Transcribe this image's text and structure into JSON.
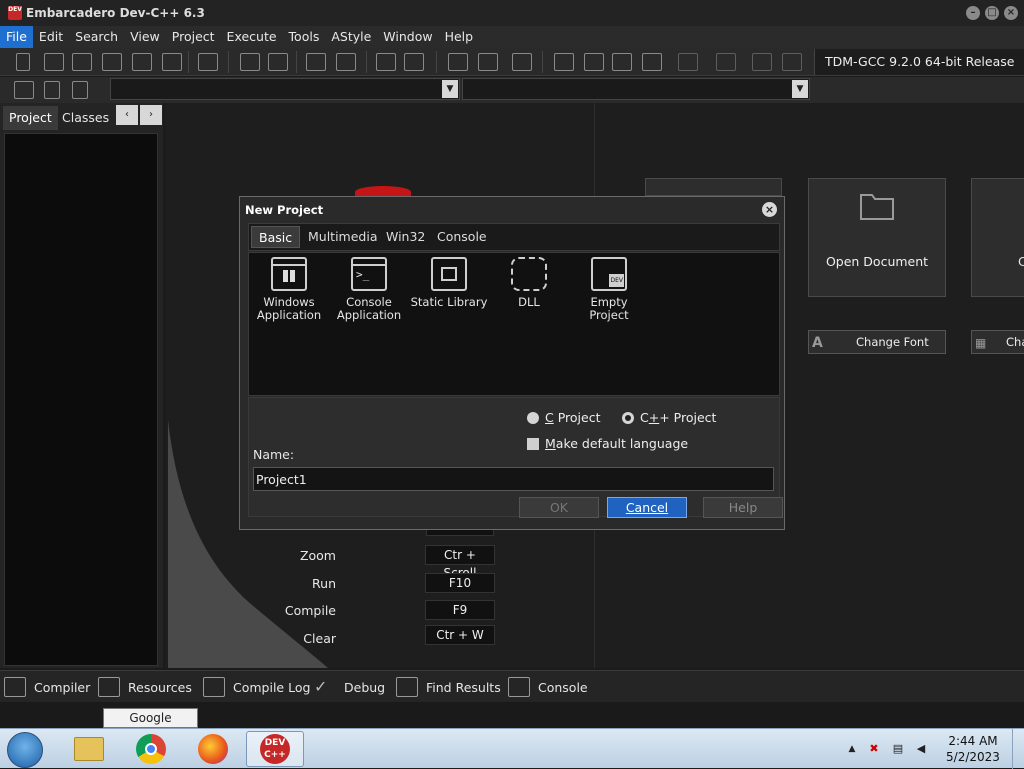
{
  "window": {
    "title": "Embarcadero Dev-C++ 6.3",
    "app_icon_text": "DEV"
  },
  "menu": [
    "File",
    "Edit",
    "Search",
    "View",
    "Project",
    "Execute",
    "Tools",
    "AStyle",
    "Window",
    "Help"
  ],
  "toolbar": {
    "compiler": "TDM-GCC 9.2.0 64-bit Release"
  },
  "left_panel": {
    "tabs": [
      "Project",
      "Classes"
    ],
    "prev": "‹",
    "next": "›"
  },
  "start_page": {
    "open_document": "Open Document",
    "partial_tile_label": "C",
    "change_font": "Change Font",
    "partial_button_label": "Cha",
    "shortcuts": [
      {
        "label": "Zoom",
        "key": "Ctr + Scroll"
      },
      {
        "label": "Run",
        "key": "F10"
      },
      {
        "label": "Compile",
        "key": "F9"
      },
      {
        "label": "Clear",
        "key": "Ctr + W"
      }
    ]
  },
  "dialog": {
    "title": "New Project",
    "tabs": [
      "Basic",
      "Multimedia",
      "Win32",
      "Console"
    ],
    "templates": [
      {
        "line1": "Windows",
        "line2": "Application",
        "icon": "window-app-icon"
      },
      {
        "line1": "Console",
        "line2": "Application",
        "icon": "console-app-icon"
      },
      {
        "line1": "Static Library",
        "line2": "",
        "icon": "static-library-icon"
      },
      {
        "line1": "DLL",
        "line2": "",
        "icon": "dll-puzzle-icon"
      },
      {
        "line1": "Empty Project",
        "line2": "",
        "icon": "empty-project-icon"
      }
    ],
    "radio_c_key": "C",
    "radio_c_rest": " Project",
    "radio_cpp_first": "C",
    "radio_cpp_key": "+",
    "radio_cpp_rest": "+ Project",
    "make_default_key": "M",
    "make_default_rest": "ake default language",
    "name_label": "Name:",
    "name_value": "Project1",
    "ok": "OK",
    "cancel": "Cancel",
    "help": "Help"
  },
  "bottom_tabs": [
    "Compiler",
    "Resources",
    "Compile Log",
    "Debug",
    "Find Results",
    "Console"
  ],
  "tooltip": "Google Chrome",
  "taskbar": {
    "time": "2:44 AM",
    "date": "5/2/2023",
    "devcpp_label": "DEV C++"
  },
  "colors": {
    "accent": "#1e6fd0",
    "cancel_button": "#1f62c0",
    "dev_red": "#c62828"
  }
}
